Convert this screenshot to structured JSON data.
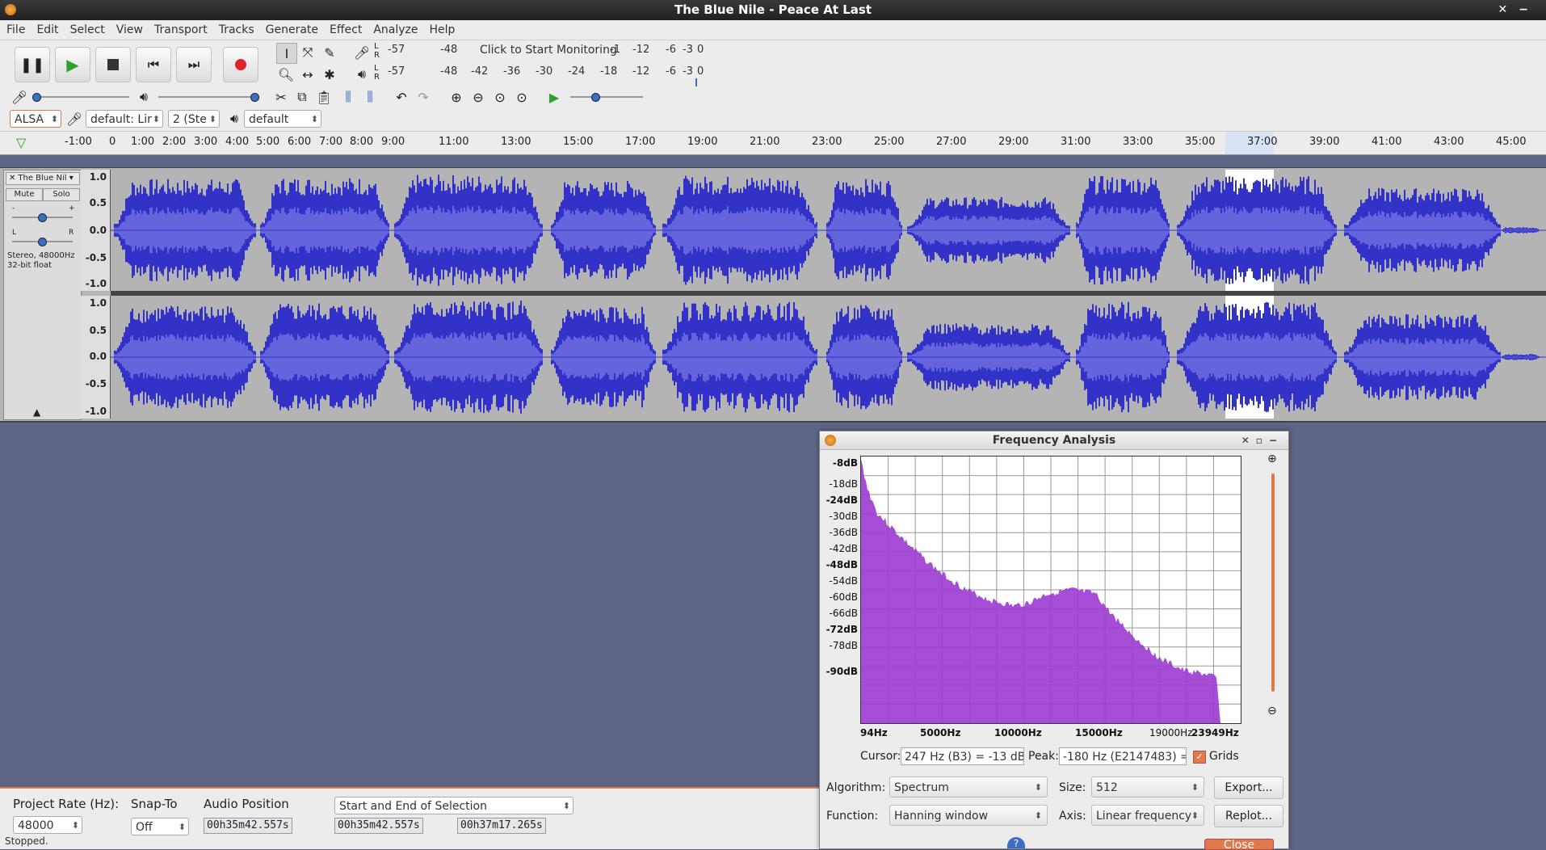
{
  "window": {
    "title": "The Blue Nile - Peace At Last"
  },
  "menu": [
    "File",
    "Edit",
    "Select",
    "View",
    "Transport",
    "Tracks",
    "Generate",
    "Effect",
    "Analyze",
    "Help"
  ],
  "meters": {
    "record_scale": [
      "-57",
      "-48",
      "Click to Start Monitoring",
      "-1",
      "-12",
      "-6",
      "-3",
      "0"
    ],
    "play_scale": [
      "-57",
      "-48",
      "-42",
      "-36",
      "-30",
      "-24",
      "-18",
      "-12",
      "-6",
      "-3",
      "0"
    ],
    "lr": [
      "L",
      "R"
    ]
  },
  "device": {
    "host": "ALSA",
    "rec_device": "default: Lir",
    "channels": "2 (Ste",
    "play_device": "default"
  },
  "ruler": {
    "ticks": [
      "-1:00",
      "0",
      "1:00",
      "2:00",
      "3:00",
      "4:00",
      "5:00",
      "6:00",
      "7:00",
      "8:00",
      "9:00",
      "11:00",
      "13:00",
      "15:00",
      "17:00",
      "19:00",
      "21:00",
      "23:00",
      "25:00",
      "27:00",
      "29:00",
      "31:00",
      "33:00",
      "35:00",
      "37:00",
      "39:00",
      "41:00",
      "43:00",
      "45:00"
    ]
  },
  "track": {
    "name": "The Blue Nil",
    "mute": "Mute",
    "solo": "Solo",
    "gain_minus": "-",
    "gain_plus": "+",
    "pan_left": "L",
    "pan_right": "R",
    "info_line1": "Stereo, 48000Hz",
    "info_line2": "32-bit float",
    "vscale": [
      "1.0",
      "0.5",
      "0.0",
      "-0.5",
      "-1.0"
    ]
  },
  "bottom": {
    "project_rate_label": "Project Rate (Hz):",
    "project_rate": "48000",
    "snap_label": "Snap-To",
    "snap_value": "Off",
    "audio_pos_label": "Audio Position",
    "audio_pos": "00h35m42.557s",
    "selection_mode": "Start and End of Selection",
    "sel_start": "00h35m42.557s",
    "sel_end": "00h37m17.265s"
  },
  "status": "Stopped.",
  "freq": {
    "title": "Frequency Analysis",
    "y_labels": [
      "-8dB",
      "-18dB",
      "-24dB",
      "-30dB",
      "-36dB",
      "-42dB",
      "-48dB",
      "-54dB",
      "-60dB",
      "-66dB",
      "-72dB",
      "-78dB",
      "-90dB"
    ],
    "x_labels": [
      "94Hz",
      "5000Hz",
      "10000Hz",
      "15000Hz",
      "19000Hz",
      "23949Hz"
    ],
    "cursor_label": "Cursor:",
    "cursor_value": "247 Hz (B3) = -13 dB",
    "peak_label": "Peak:",
    "peak_value": "-180 Hz (E2147483) =",
    "grids_label": "Grids",
    "algorithm_label": "Algorithm:",
    "algorithm": "Spectrum",
    "size_label": "Size:",
    "size": "512",
    "export_label": "Export...",
    "function_label": "Function:",
    "function": "Hanning window",
    "axis_label": "Axis:",
    "axis": "Linear frequency",
    "replot_label": "Replot...",
    "close_label": "Close",
    "help_label": "?",
    "accent": "#9b3ad0"
  }
}
